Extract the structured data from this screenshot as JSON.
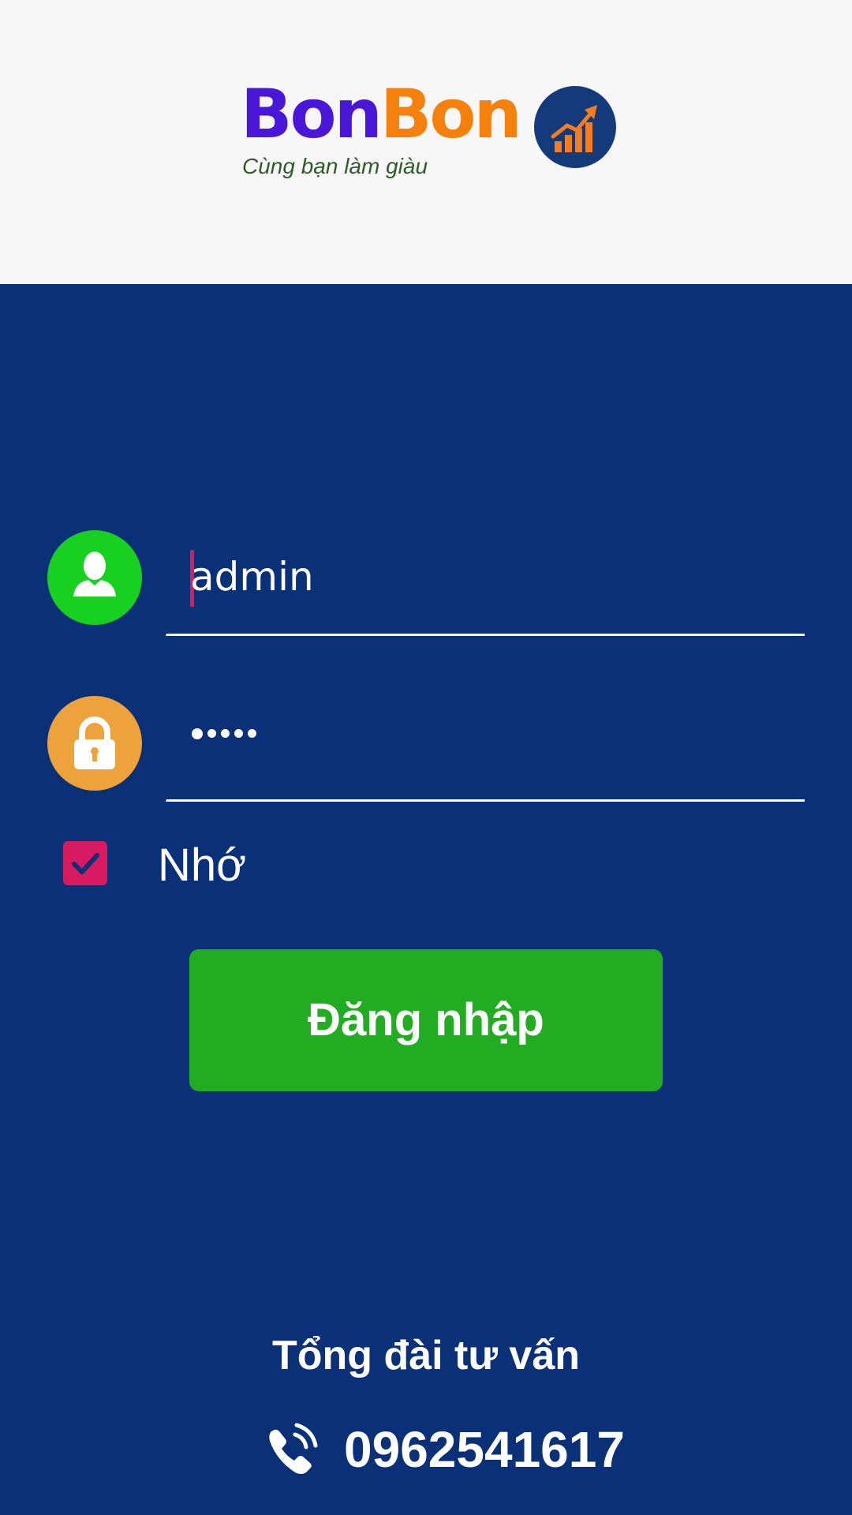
{
  "header": {
    "brand_part1": "Bon",
    "brand_part2": "Bon",
    "tagline": "Cùng bạn làm giàu",
    "logo_icon": "growth-chart-icon"
  },
  "form": {
    "username": {
      "icon": "user-icon",
      "value": "admin"
    },
    "password": {
      "icon": "lock-icon",
      "masked_length": 5
    },
    "remember": {
      "label": "Nhớ",
      "checked": true
    },
    "login_button": "Đăng nhập"
  },
  "footer": {
    "hotline_title": "Tổng đài tư vấn",
    "phone_icon": "phone-icon",
    "phone_number": "0962541617"
  },
  "colors": {
    "background": "#0a3178",
    "header_background": "#f7f7f7",
    "user_icon_bg": "#17d01f",
    "lock_icon_bg": "#eda23b",
    "checkbox": "#d81b60",
    "button": "#22ac22",
    "brand_purple": "#4a16d8",
    "brand_orange": "#f5800c"
  }
}
